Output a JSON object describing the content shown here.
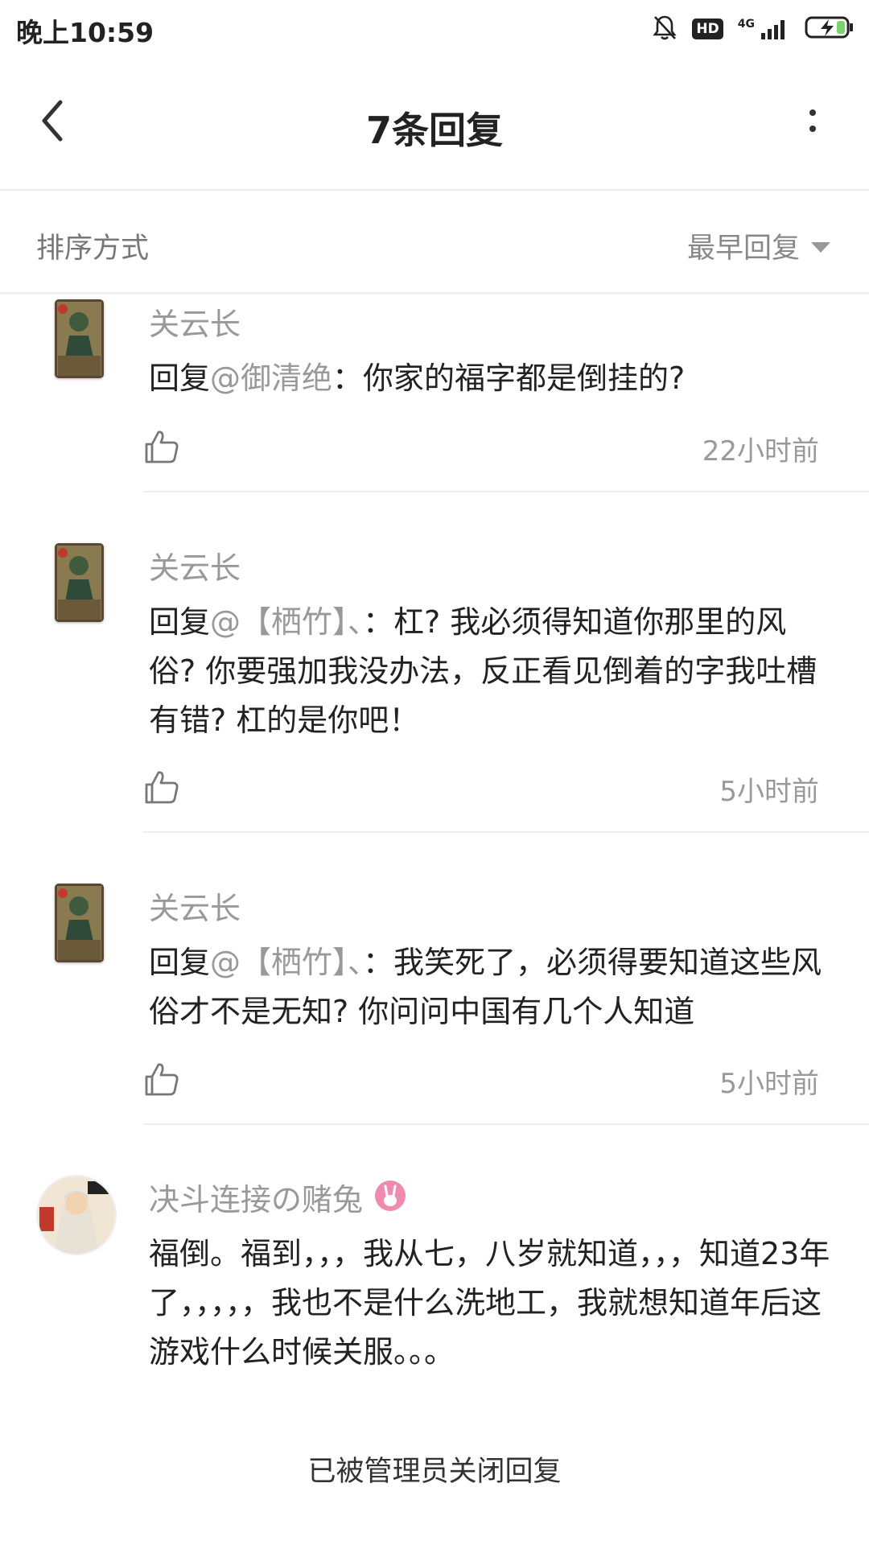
{
  "status_bar": {
    "time": "晚上10:59",
    "hd": "HD",
    "network": "4G"
  },
  "header": {
    "title": "7条回复"
  },
  "sort": {
    "label": "排序方式",
    "value": "最早回复"
  },
  "comments": [
    {
      "username": "关云长",
      "prefix": "回复",
      "mention": "@御清绝",
      "text": "：你家的福字都是倒挂的?",
      "time": "22小时前"
    },
    {
      "username": "关云长",
      "prefix": "回复",
      "mention": "@【栖竹】、",
      "text": "：杠? 我必须得知道你那里的风俗? 你要强加我没办法，反正看见倒着的字我吐槽有错? 杠的是你吧！",
      "time": "5小时前"
    },
    {
      "username": "关云长",
      "prefix": "回复",
      "mention": "@【栖竹】、",
      "text": "：我笑死了，必须得要知道这些风俗才不是无知? 你问问中国有几个人知道",
      "time": "5小时前"
    },
    {
      "username": "决斗连接の赌兔",
      "text": "福倒。福到，，，我从七，八岁就知道，，，知道23年了，，，，，我也不是什么洗地工，我就想知道年后这游戏什么时候关服。。。"
    }
  ],
  "footer": {
    "closed_notice": "已被管理员关闭回复"
  },
  "colors": {
    "muted": "#999999",
    "text": "#222222",
    "divider": "#eeeeee",
    "badge_pink": "#f08bb0"
  }
}
